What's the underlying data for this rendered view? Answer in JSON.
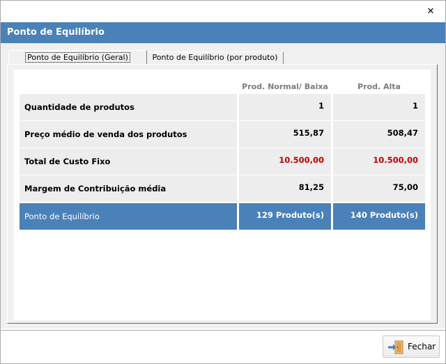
{
  "window": {
    "close_glyph": "✕",
    "title": "Ponto de Equilíbrio"
  },
  "tabs": [
    {
      "label": "Ponto de Equilíbrio (Geral)",
      "active": true
    },
    {
      "label": "Ponto de Equilíbrio (por produto)",
      "active": false
    }
  ],
  "table": {
    "columns": [
      "Prod. Normal/ Baixa",
      "Prod. Alta"
    ],
    "rows": [
      {
        "label": "Quantidade de produtos",
        "values": [
          "1",
          "1"
        ]
      },
      {
        "label": "Preço médio de venda dos produtos",
        "values": [
          "515,87",
          "508,47"
        ]
      },
      {
        "label": "Total de Custo Fixo",
        "values": [
          "10.500,00",
          "10.500,00"
        ],
        "value_color": "#c00000"
      },
      {
        "label": "Margem de Contribuição média",
        "values": [
          "81,25",
          "75,00"
        ]
      },
      {
        "label": "Ponto de Equilíbrio",
        "values": [
          "129 Produto(s)",
          "140 Produto(s)"
        ],
        "highlight_color": "#4a81b8"
      }
    ]
  },
  "footer": {
    "close_button_label": "Fechar",
    "close_button_icon": "exit-door-icon"
  },
  "colors": {
    "header_bg": "#4a81b8",
    "accent_red": "#c00000"
  }
}
